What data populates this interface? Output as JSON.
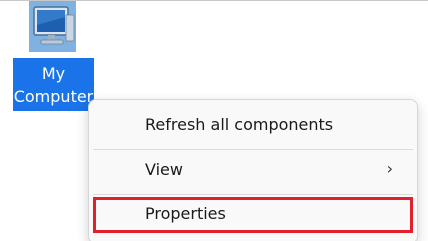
{
  "desktop": {
    "icon": {
      "name": "monitor-icon",
      "label_line1": "My",
      "label_line2": "Computer"
    }
  },
  "context_menu": {
    "items": [
      {
        "label": "Refresh all components",
        "has_submenu": false
      },
      {
        "label": "View",
        "has_submenu": true,
        "submenu_glyph": "›"
      },
      {
        "label": "Properties",
        "has_submenu": false,
        "highlighted": true
      }
    ]
  },
  "colors": {
    "selection_blue": "#1a73e8",
    "highlight_red": "#e0202c",
    "menu_background": "#f9f9f9"
  }
}
